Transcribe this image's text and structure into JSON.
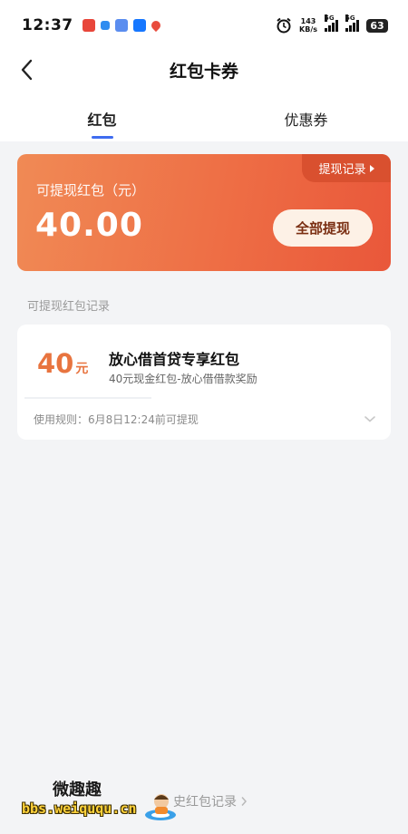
{
  "status_bar": {
    "time": "12:37",
    "net_speed_value": "143",
    "net_speed_unit": "KB/s",
    "signal_1_label": "5G",
    "signal_2_label": "5G",
    "battery": "63"
  },
  "header": {
    "title": "红包卡券"
  },
  "tabs": [
    {
      "label": "红包",
      "active": true
    },
    {
      "label": "优惠券",
      "active": false
    }
  ],
  "balance_card": {
    "record_tag": "提现记录",
    "label": "可提现红包（元）",
    "amount": "40.00",
    "withdraw_button": "全部提现"
  },
  "section_label": "可提现红包记录",
  "coupon": {
    "amount_number": "40",
    "amount_unit": "元",
    "title": "放心借首贷专享红包",
    "description": "40元现金红包-放心借借款奖励",
    "rule": "使用规则：6月8日12:24前可提现"
  },
  "history_link": "史红包记录",
  "watermark": {
    "title": "微趣趣",
    "url": "bbs.weiququ.cn"
  },
  "colors": {
    "accent_blue": "#3f6cf0",
    "card_orange": "#ee6e45",
    "amount_orange": "#e8743f"
  }
}
